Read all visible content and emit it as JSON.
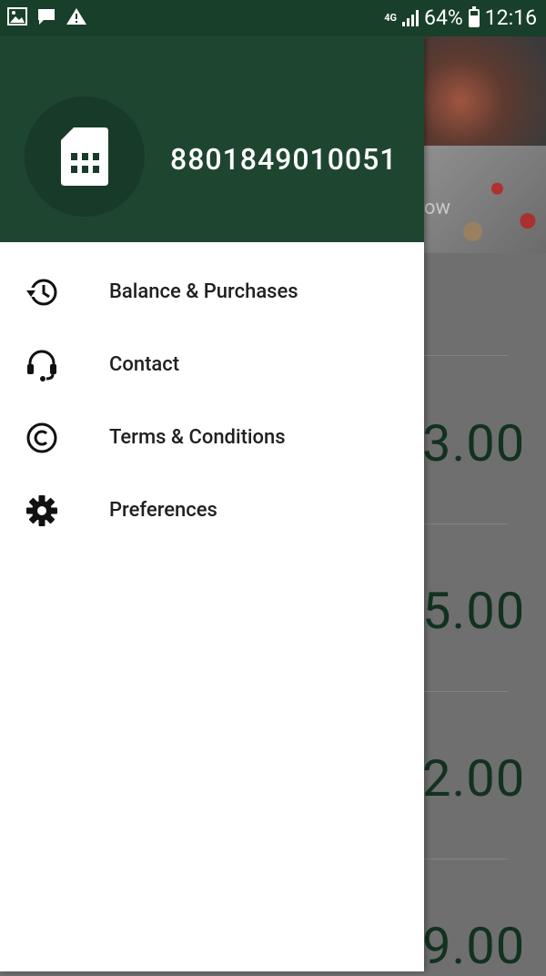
{
  "status_bar": {
    "network_type": "4G",
    "battery_percent": "64%",
    "battery_level": 0.64,
    "time": "12:16",
    "left_icons": [
      "image-icon",
      "chat-icon",
      "warning-icon"
    ]
  },
  "drawer": {
    "header": {
      "phone_number": "8801849010051",
      "avatar_icon": "sim-card-icon",
      "background_color": "#1e4530"
    },
    "items": [
      {
        "label": "Balance & Purchases",
        "icon": "history-icon"
      },
      {
        "label": "Contact",
        "icon": "headset-icon"
      },
      {
        "label": "Terms & Conditions",
        "icon": "copyright-icon"
      },
      {
        "label": "Preferences",
        "icon": "gear-icon"
      }
    ]
  },
  "background_screen": {
    "banner_partial_text": "ow",
    "amounts_partial": [
      "3.00",
      "5.00",
      "2.00",
      "9.00"
    ]
  },
  "colors": {
    "primary": "#1e4530",
    "status_bar": "#183f2a",
    "amount_text": "#12321f"
  }
}
